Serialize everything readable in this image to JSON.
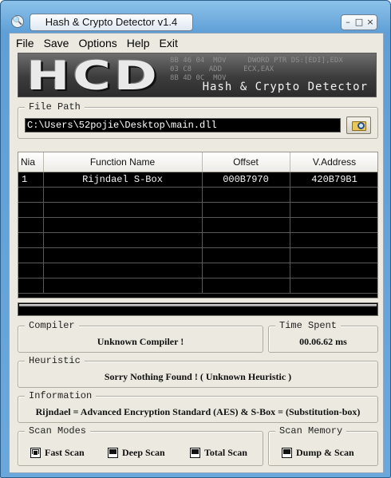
{
  "window": {
    "title": "Hash & Crypto Detector v1.4",
    "controls": [
      "–",
      "□",
      "×"
    ]
  },
  "menu": [
    "File",
    "Save",
    "Options",
    "Help",
    "Exit"
  ],
  "banner": {
    "logo": "HCD",
    "tagline": "Hash & Crypto Detector",
    "code_lines": [
      "8B 46 04  MOV     DWORD PTR DS:[EDI],EDX",
      "03 C8    ADD     ECX,EAX",
      "8B 4D 0C  MOV"
    ]
  },
  "file_path": {
    "legend": "File Path",
    "value": "C:\\Users\\52pojie\\Desktop\\main.dll",
    "browse_icon": "folder-search-icon"
  },
  "results": {
    "columns": [
      "Nia",
      "Function Name",
      "Offset",
      "V.Address"
    ],
    "rows": [
      [
        "1",
        "Rijndael S-Box",
        "000B7970",
        "420B79B1"
      ],
      [
        "",
        "",
        "",
        ""
      ],
      [
        "",
        "",
        "",
        ""
      ],
      [
        "",
        "",
        "",
        ""
      ],
      [
        "",
        "",
        "",
        ""
      ],
      [
        "",
        "",
        "",
        ""
      ],
      [
        "",
        "",
        "",
        ""
      ],
      [
        "",
        "",
        "",
        ""
      ]
    ]
  },
  "progress": {
    "fraction": 1.0
  },
  "compiler": {
    "legend": "Compiler",
    "value": "Unknown Compiler !"
  },
  "time_spent": {
    "legend": "Time Spent",
    "value": "00.06.62 ms"
  },
  "heuristic": {
    "legend": "Heuristic",
    "value": "Sorry Nothing Found !  ( Unknown Heuristic )"
  },
  "information": {
    "legend": "Information",
    "value": "Rijndael = Advanced Encryption Standard (AES) & S-Box = (Substitution-box)"
  },
  "scan_modes": {
    "legend": "Scan Modes",
    "options": [
      {
        "label": "Fast Scan",
        "checked": true
      },
      {
        "label": "Deep Scan",
        "checked": false
      },
      {
        "label": "Total Scan",
        "checked": false
      }
    ]
  },
  "scan_memory": {
    "legend": "Scan Memory",
    "options": [
      {
        "label": "Dump & Scan",
        "checked": false
      }
    ]
  }
}
